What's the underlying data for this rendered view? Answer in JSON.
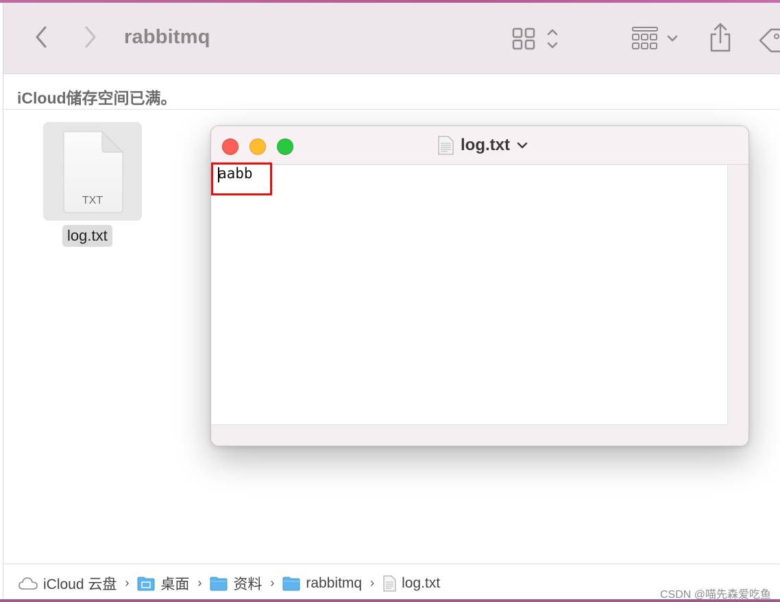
{
  "toolbar": {
    "folder_title": "rabbitmq",
    "back_icon": "chevron-left-icon",
    "forward_icon": "chevron-right-icon",
    "view_icon": "grid-view-icon",
    "group_icon": "group-by-icon",
    "share_icon": "share-icon",
    "tag_icon": "tag-icon"
  },
  "banner": {
    "message": "iCloud储存空间已满。"
  },
  "files": [
    {
      "name": "log.txt",
      "type_label": "TXT"
    }
  ],
  "textedit": {
    "title": "log.txt",
    "content": "aabb",
    "colors": {
      "close": "#fe5f57",
      "minimize": "#febc2e",
      "zoom": "#28c840",
      "highlight_box": "#e51010"
    }
  },
  "pathbar": {
    "items": [
      "iCloud 云盘",
      "桌面",
      "资料",
      "rabbitmq",
      "log.txt"
    ]
  },
  "watermark": "CSDN @喵先森爱吃鱼"
}
